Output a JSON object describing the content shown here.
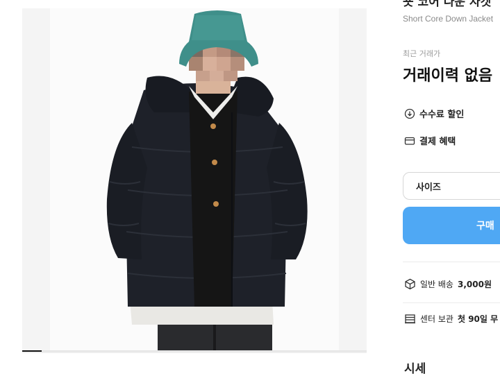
{
  "product": {
    "title_cut": "숏 코어 다운 자켓",
    "subtitle": "Short Core Down Jacket"
  },
  "gallery": {
    "image_alt": "black short padded down jacket worn by model with teal bucket hat",
    "progress_fraction": 0.056
  },
  "recent_trade": {
    "label": "최근 거래가",
    "value": "거래이력 없음"
  },
  "benefits": {
    "fee_discount": "수수료 할인",
    "payment_benefit": "결제 혜택"
  },
  "size_select": {
    "label": "사이즈"
  },
  "buy_button": {
    "label": "구매"
  },
  "shipping": {
    "normal_label": "일반 배송",
    "normal_price": "3,000원",
    "center_label": "센터 보관",
    "center_value": "첫 90일 무"
  },
  "section": {
    "market_price": "시세"
  },
  "colors": {
    "buy_button": "#4fa8f4",
    "jacket": "#1c1f26",
    "hat": "#3f8f8a"
  }
}
